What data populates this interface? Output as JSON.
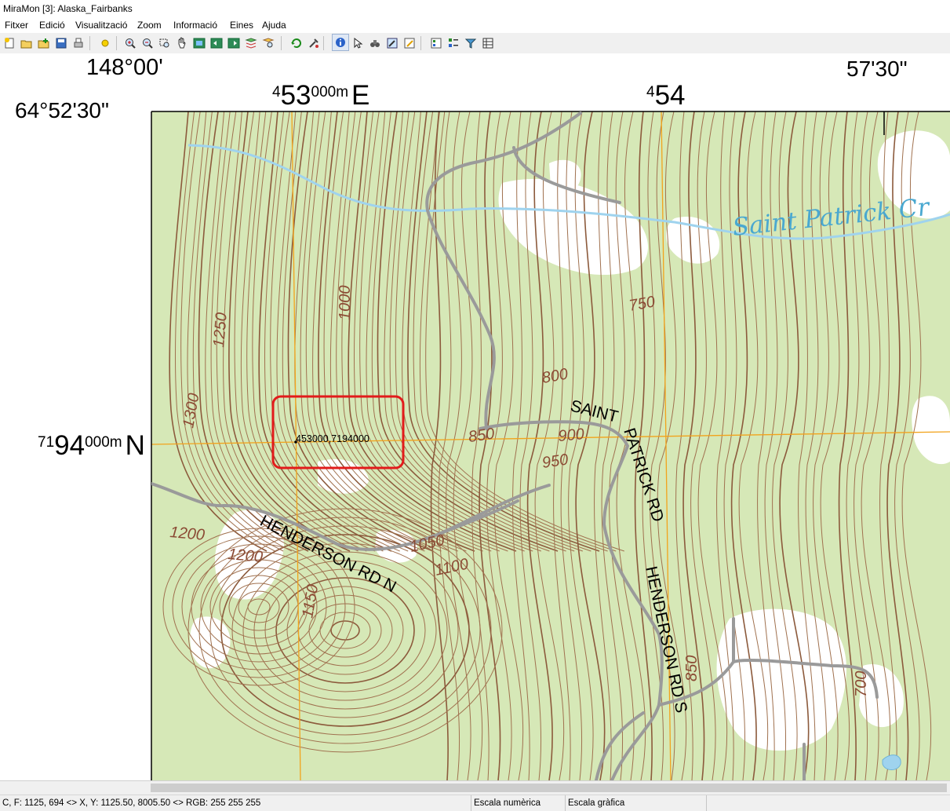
{
  "window": {
    "title": "MiraMon [3]:  Alaska_Fairbanks"
  },
  "menu": [
    {
      "label": "Fitxer"
    },
    {
      "label": "Edició"
    },
    {
      "label": "Visualització"
    },
    {
      "label": "Zoom"
    },
    {
      "label": "Informació"
    },
    {
      "label": "Eines"
    },
    {
      "label": "Ajuda"
    }
  ],
  "toolbar": {
    "buttons": [
      "new-icon",
      "open-icon",
      "add-layer-icon",
      "save-icon",
      "print-icon",
      "refresh-sun-icon",
      "zoom-in-icon",
      "zoom-out-icon",
      "zoom-window-icon",
      "pan-hand-icon",
      "view-all-icon",
      "previous-view-icon",
      "next-view-icon",
      "zoom-layer-icon",
      "zoom-selection-icon",
      "redraw-icon",
      "tools-icon",
      "info-icon",
      "select-arrow-icon",
      "binoculars-icon",
      "edit-icon",
      "pencil-icon",
      "legend-icon",
      "layers-icon",
      "filter-icon",
      "table-icon"
    ]
  },
  "map": {
    "graticule": {
      "lon_left": "148°00'",
      "lon_right": "57'30\"",
      "lat_top": "64°52'30\""
    },
    "utm": {
      "easting_1_prefix": "4",
      "easting_1_main": "53",
      "easting_1_suffix": "000m",
      "easting_1_unit": "E",
      "easting_2_prefix": "4",
      "easting_2_main": "54",
      "northing_prefix": "71",
      "northing_main": "94",
      "northing_suffix": "000m",
      "northing_unit": "N"
    },
    "feature_labels": {
      "creek": "Saint Patrick Cr",
      "road_henderson_n": "HENDERSON RD N",
      "road_henderson_s": "HENDERSON RD S",
      "road_saint": "SAINT",
      "road_patrick": "PATRICK RD"
    },
    "contour_labels": [
      "750",
      "800",
      "850",
      "900",
      "950",
      "1000",
      "1050",
      "1100",
      "1150",
      "1200",
      "1200",
      "1250",
      "1300",
      "850",
      "700"
    ],
    "selected_point": "453000,7194000",
    "colors": {
      "vegetation": "#d6e8b7",
      "open_ground": "#ffffff",
      "contour": "#a0714f",
      "index_contour": "#8c5a3c",
      "water": "#9fd3ee",
      "grid": "#f2a31c",
      "road": "#9a9a9a",
      "highlight": "#e21b1b"
    }
  },
  "status": {
    "cursor": "C, F: 1125, 694 <> X, Y: 1125.50, 8005.50 <> RGB:  255 255 255",
    "numeric_scale": "Escala numèrica",
    "graphic_scale": "Escala gràfica"
  }
}
